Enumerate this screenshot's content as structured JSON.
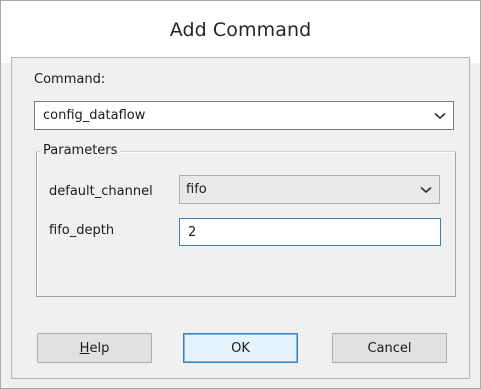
{
  "window": {
    "title": "Add Command"
  },
  "command": {
    "label": "Command:",
    "selected": "config_dataflow",
    "dropdown_icon": "chevron-down-icon"
  },
  "parameters": {
    "group_title": "Parameters",
    "rows": [
      {
        "label": "default_channel",
        "type": "select",
        "value": "fifo",
        "dropdown_icon": "chevron-down-icon"
      },
      {
        "label": "fifo_depth",
        "type": "text",
        "value": "2"
      }
    ]
  },
  "buttons": {
    "help": "Help",
    "ok": "OK",
    "cancel": "Cancel"
  },
  "colors": {
    "dialog_background": "#f0f0f0",
    "title_background": "#ffffff",
    "focus_border": "#3c7fb1"
  }
}
